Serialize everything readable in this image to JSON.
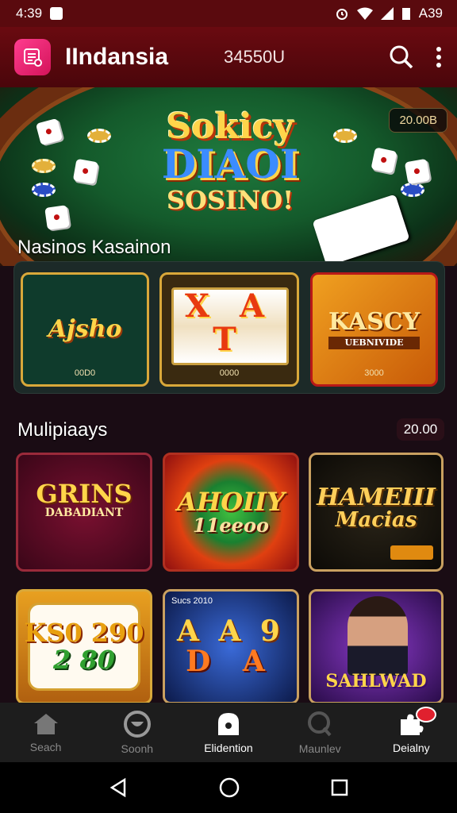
{
  "status": {
    "time": "4:39",
    "battery_text": "A39"
  },
  "app": {
    "title": "IIndansia",
    "count": "34550U"
  },
  "hero": {
    "title_line1": "Sokicy",
    "title_line2": "DIAOI",
    "title_line3": "SOSINO!",
    "badge": "20.00B"
  },
  "sections": {
    "kasino_title": "Nasinos Kasainon",
    "multi_title": "Mulipiaays",
    "multi_count": "20.00"
  },
  "kasino_cards": [
    {
      "label": "Ajsho",
      "sub": "00D0"
    },
    {
      "label": "X A T",
      "sub": "0000"
    },
    {
      "label": "KASCY",
      "label2": "UEBNIVIDE",
      "sub": "3000"
    }
  ],
  "multi_cards_row1": [
    {
      "label": "GRINS",
      "label2": "DABADIANT"
    },
    {
      "label": "AHOIIY",
      "label2": "11eeoo"
    },
    {
      "label": "HAMEIII",
      "label2": "Macias"
    }
  ],
  "multi_cards_row2": [
    {
      "label": "KS0 290",
      "label2": "2 80"
    },
    {
      "label": "A A 9",
      "label2": "D A",
      "corner": "Sucs 2010"
    },
    {
      "label": "SAHLWAD"
    }
  ],
  "nav": [
    {
      "label": "Seach",
      "icon": "home-icon"
    },
    {
      "label": "Soonh",
      "icon": "chat-icon"
    },
    {
      "label": "Elidention",
      "icon": "lock-icon"
    },
    {
      "label": "Maunlev",
      "icon": "search-q-icon"
    },
    {
      "label": "Deialny",
      "icon": "puzzle-icon"
    }
  ],
  "colors": {
    "accent": "#d4145a",
    "appbar": "#5a0a0e",
    "gold": "#d9a83a"
  }
}
